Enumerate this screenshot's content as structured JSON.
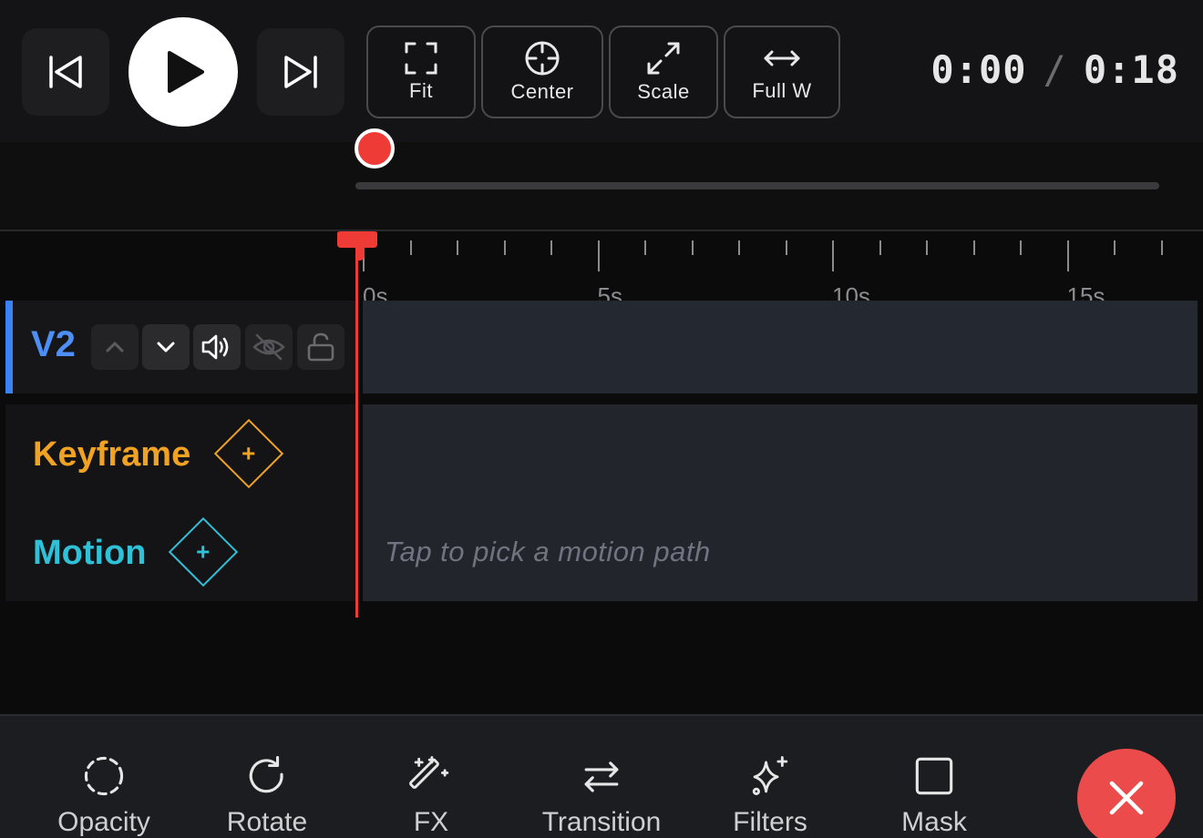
{
  "transport": {
    "prev_icon": "skip-back-icon",
    "play_icon": "play-icon",
    "next_icon": "skip-forward-icon"
  },
  "view_buttons": {
    "fit": {
      "label": "Fit",
      "icon": "fit-frame-icon"
    },
    "center": {
      "label": "Center",
      "icon": "crosshair-icon"
    },
    "scale": {
      "label": "Scale",
      "icon": "expand-arrows-icon"
    },
    "full_w": {
      "label": "Full W",
      "icon": "horizontal-arrows-icon"
    }
  },
  "timecode": {
    "current": "0:00",
    "separator": "/",
    "total": "0:18"
  },
  "scrubber": {
    "position": 0.0
  },
  "ruler": {
    "labels": [
      "0s",
      "5s",
      "10s",
      "15s"
    ]
  },
  "track": {
    "name": "V2",
    "controls": [
      "move-up",
      "move-down",
      "audio",
      "visibility-off",
      "lock-open"
    ]
  },
  "lanes": {
    "keyframe": {
      "label": "Keyframe",
      "add_symbol": "+"
    },
    "motion": {
      "label": "Motion",
      "add_symbol": "+",
      "hint": "Tap to pick a motion path"
    }
  },
  "toolbar": {
    "opacity": "Opacity",
    "rotate": "Rotate",
    "fx": "FX",
    "transition": "Transition",
    "filters": "Filters",
    "mask": "Mask"
  },
  "colors": {
    "accent_red": "#ef3b36",
    "track_blue": "#4d8ff5",
    "keyframe_orange": "#f0a323",
    "motion_cyan": "#2fc1d8",
    "close_red": "#ec4b4b"
  }
}
